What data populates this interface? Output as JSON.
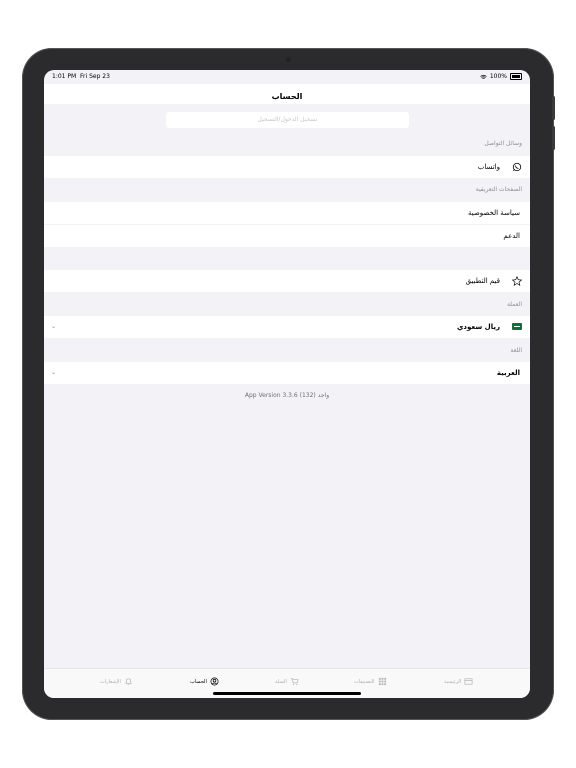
{
  "status": {
    "time": "1:01 PM",
    "date": "Fri Sep 23",
    "battery": "100%"
  },
  "header": {
    "title": "الحساب"
  },
  "login": {
    "text": "تسجيل الدخول/التسجيل"
  },
  "sections": {
    "social": "وسائل التواصل",
    "pages": "الصفحات التعريفية",
    "currency": "العملة",
    "language": "اللغة"
  },
  "rows": {
    "whatsapp": "واتساب",
    "privacy": "سياسة الخصوصية",
    "support": "الدعم",
    "rate_app": "قيم التطبيق",
    "currency_value": "ريال سعودي",
    "language_value": "العربية"
  },
  "version": {
    "text": "App Version 3.3.6 (132) واجد"
  },
  "tabs": {
    "notifications": "الإشعارات",
    "account": "الحساب",
    "cart": "السلة",
    "categories": "التصنيفات",
    "home": "الرئيسية"
  },
  "icons": [
    "whatsapp-icon",
    "star-icon",
    "saudi-flag-icon",
    "chevron-down-icon",
    "bell-icon",
    "user-circle-icon",
    "cart-icon",
    "grid-icon",
    "home-icon",
    "wifi-icon",
    "battery-icon"
  ]
}
